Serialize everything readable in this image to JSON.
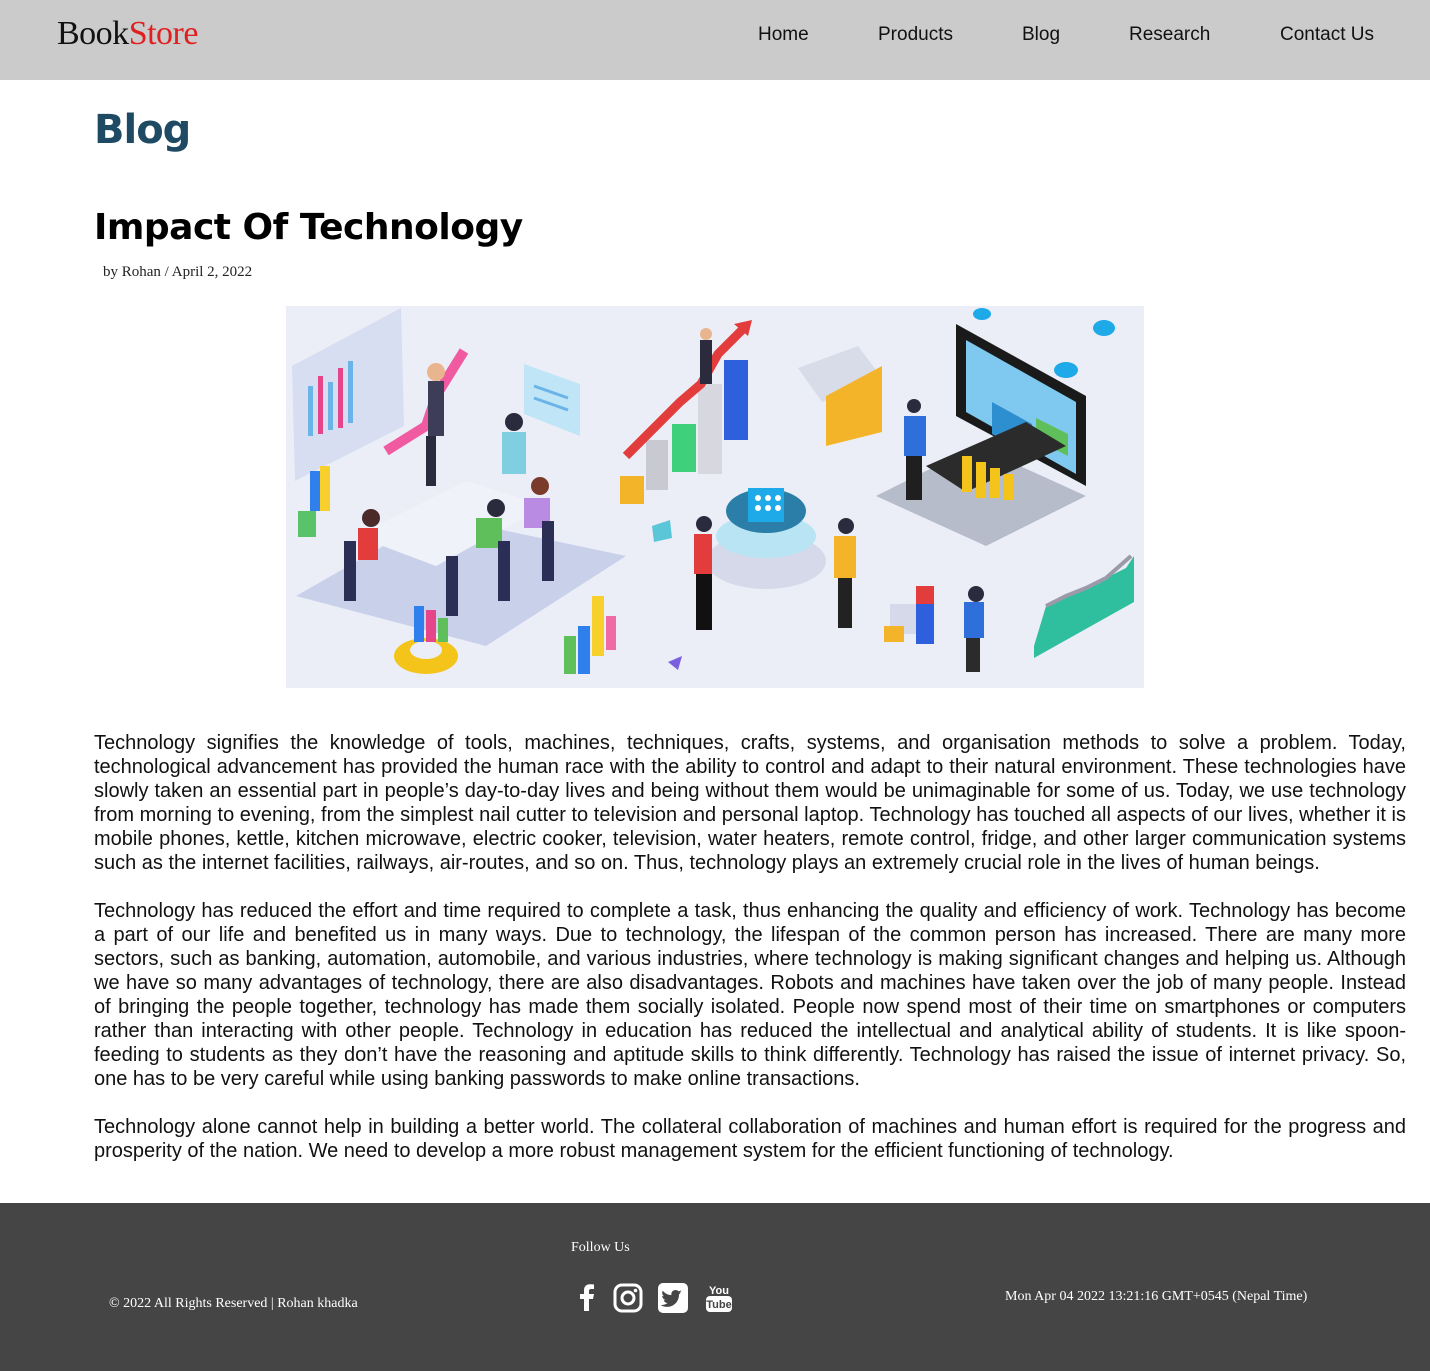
{
  "header": {
    "logo_part1": "Book",
    "logo_part2": "Store",
    "nav": [
      "Home",
      "Products",
      "Blog",
      "Research",
      "Contact Us"
    ]
  },
  "page": {
    "heading": "Blog"
  },
  "post": {
    "title": "Impact Of Technology",
    "byline": "by Rohan / April 2, 2022",
    "paragraphs": [
      "Technology signifies the knowledge of tools, machines, techniques, crafts, systems, and organisation methods to solve a problem. Today, technological advancement has provided the human race with the ability to control and adapt to their natural environment. These technologies have slowly taken an essential part in people’s day-to-day lives and being without them would be unimaginable for some of us. Today, we use technology from morning to evening, from the simplest nail cutter to television and personal laptop. Technology has touched all aspects of our lives, whether it is mobile phones, kettle, kitchen microwave, electric cooker, television, water heaters, remote control, fridge, and other larger communication systems such as the internet facilities, railways, air-routes, and so on. Thus, technology plays an extremely crucial role in the lives of human beings.",
      "Technology has reduced the effort and time required to complete a task, thus enhancing the quality and efficiency of work. Technology has become a part of our life and benefited us in many ways. Due to technology, the lifespan of the common person has increased. There are many more sectors, such as banking, automation, automobile, and various industries, where technology is making significant changes and helping us. Although we have so many advantages of technology, there are also disadvantages. Robots and machines have taken over the job of many people. Instead of bringing the people together, technology has made them socially isolated. People now spend most of their time on smartphones or computers rather than interacting with other people. Technology in education has reduced the intellectual and analytical ability of students. It is like spoon-feeding to students as they don’t have the reasoning and aptitude skills to think differently. Technology has raised the issue of internet privacy. So, one has to be very careful while using banking passwords to make online transactions.",
      "Technology alone cannot help in building a better world. The collateral collaboration of machines and human effort is required for the progress and prosperity of the nation. We need to develop a more robust management system for the efficient functioning of technology."
    ]
  },
  "footer": {
    "copyright": "© 2022 All Rights Reserved | Rohan khadka",
    "follow_label": "Follow Us",
    "socials": [
      "facebook-icon",
      "instagram-icon",
      "twitter-icon",
      "youtube-icon"
    ],
    "clock": "Mon Apr 04 2022 13:21:16 GMT+0545 (Nepal Time)"
  },
  "colors": {
    "header_bg": "#cbcbcb",
    "logo_accent": "#e02020",
    "heading": "#1e4a63",
    "footer_bg": "#454545"
  }
}
